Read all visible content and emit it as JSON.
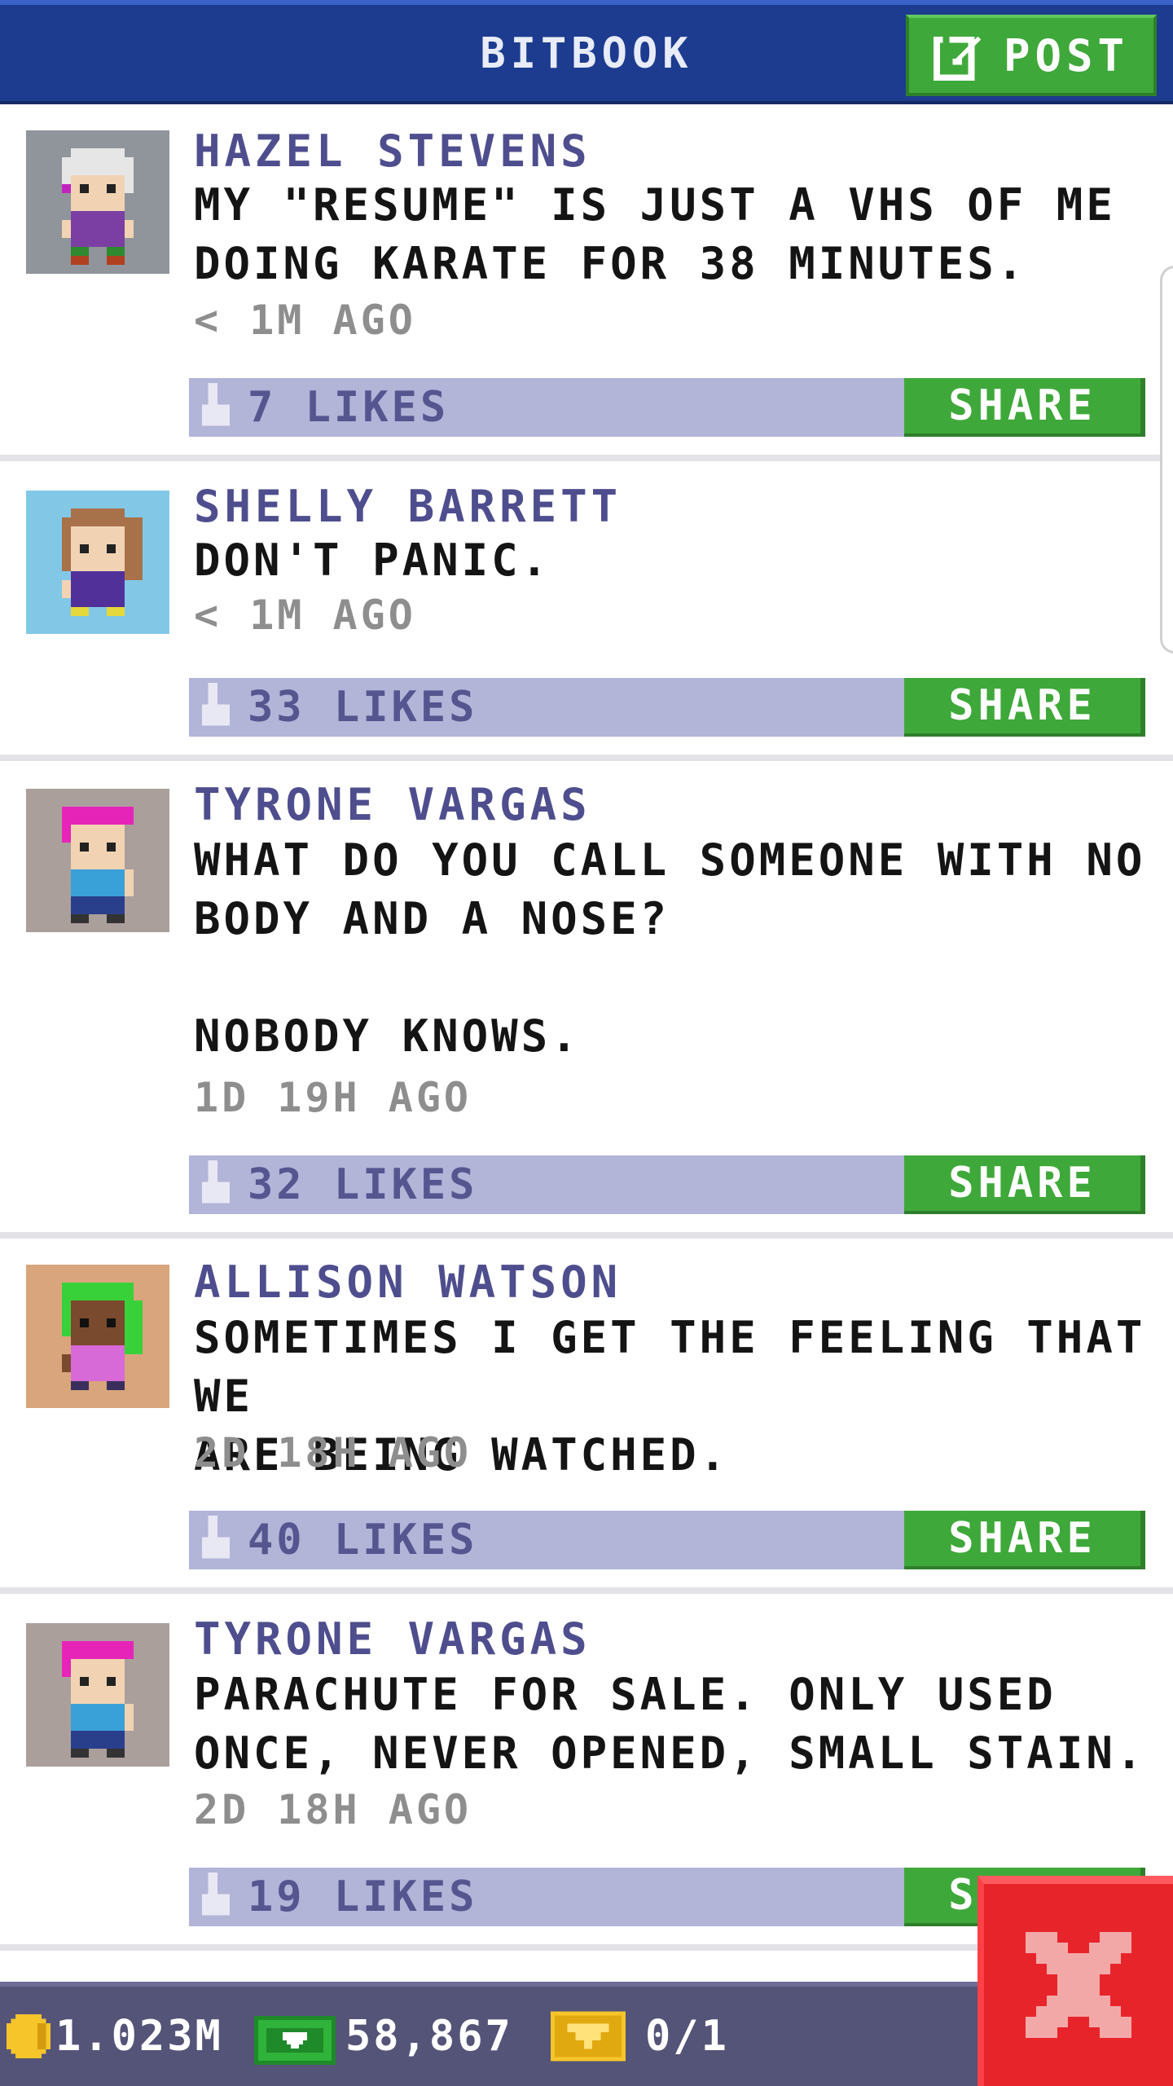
{
  "header": {
    "title": "BITBOOK",
    "post_label": "POST"
  },
  "posts": [
    {
      "author": "HAZEL STEVENS",
      "message": "MY \"RESUME\" IS JUST A VHS OF ME\nDOING KARATE FOR 38 MINUTES.",
      "time": "< 1M AGO",
      "likes": "7 LIKES",
      "share": "SHARE"
    },
    {
      "author": "SHELLY BARRETT",
      "message": "DON'T PANIC.",
      "time": "< 1M AGO",
      "likes": "33 LIKES",
      "share": "SHARE"
    },
    {
      "author": "TYRONE VARGAS",
      "message": "WHAT DO YOU CALL SOMEONE WITH NO\nBODY AND A NOSE?\n\nNOBODY KNOWS.",
      "time": "1D 19H AGO",
      "likes": "32 LIKES",
      "share": "SHARE"
    },
    {
      "author": "ALLISON WATSON",
      "message": "SOMETIMES I GET THE FEELING THAT WE\nARE BEING WATCHED.",
      "time": "2D 18H AGO",
      "likes": "40 LIKES",
      "share": "SHARE"
    },
    {
      "author": "TYRONE VARGAS",
      "message": "PARACHUTE FOR SALE. ONLY USED\nONCE, NEVER OPENED, SMALL STAIN.",
      "time": "2D 18H AGO",
      "likes": "19 LIKES",
      "share": "SHARE"
    }
  ],
  "footer": {
    "coins": "1.023M",
    "bux": "58,867",
    "tickets": "0/1"
  },
  "colors": {
    "header": "#1d3c8f",
    "accent_green": "#3fa83a",
    "likes_bar": "#b2b4d8",
    "author": "#4e4e8e",
    "close": "#e8242b"
  }
}
